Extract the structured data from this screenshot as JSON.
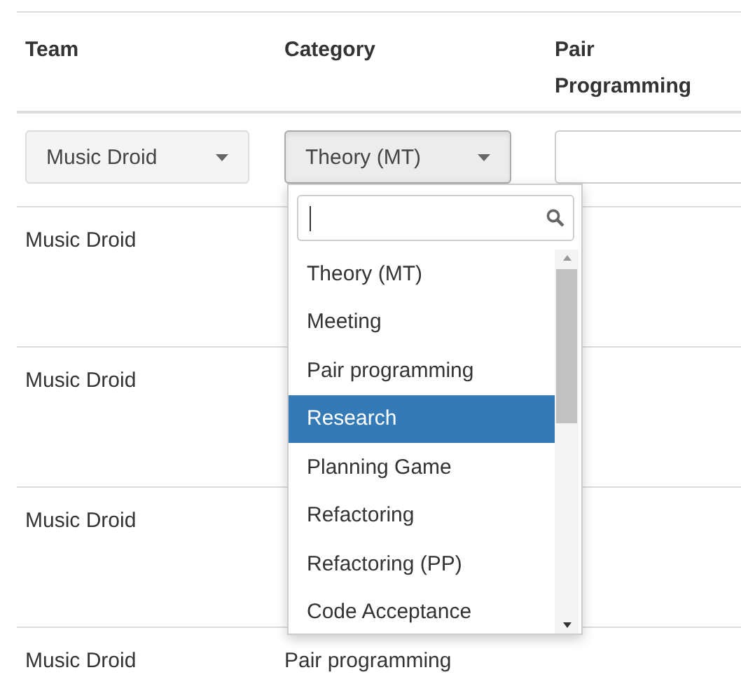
{
  "table": {
    "columns": [
      "Team",
      "Category",
      "Pair Programming"
    ],
    "filters": [
      {
        "kind": "select",
        "value": "Music Droid",
        "open": false
      },
      {
        "kind": "select",
        "value": "Theory (MT)",
        "open": true
      },
      {
        "kind": "text"
      }
    ],
    "rows": [
      {
        "team": "Music Droid"
      },
      {
        "team": "Music Droid"
      },
      {
        "team": "Music Droid"
      },
      {
        "team": "Music Droid",
        "category": "Pair programming"
      }
    ]
  },
  "dropdown": {
    "options": [
      {
        "label": "Theory (MT)",
        "selected": false
      },
      {
        "label": "Meeting",
        "selected": false
      },
      {
        "label": "Pair programming",
        "selected": false
      },
      {
        "label": "Research",
        "selected": true
      },
      {
        "label": "Planning Game",
        "selected": false
      },
      {
        "label": "Refactoring",
        "selected": false
      },
      {
        "label": "Refactoring (PP)",
        "selected": false
      },
      {
        "label": "Code Acceptance",
        "selected": false
      }
    ]
  }
}
